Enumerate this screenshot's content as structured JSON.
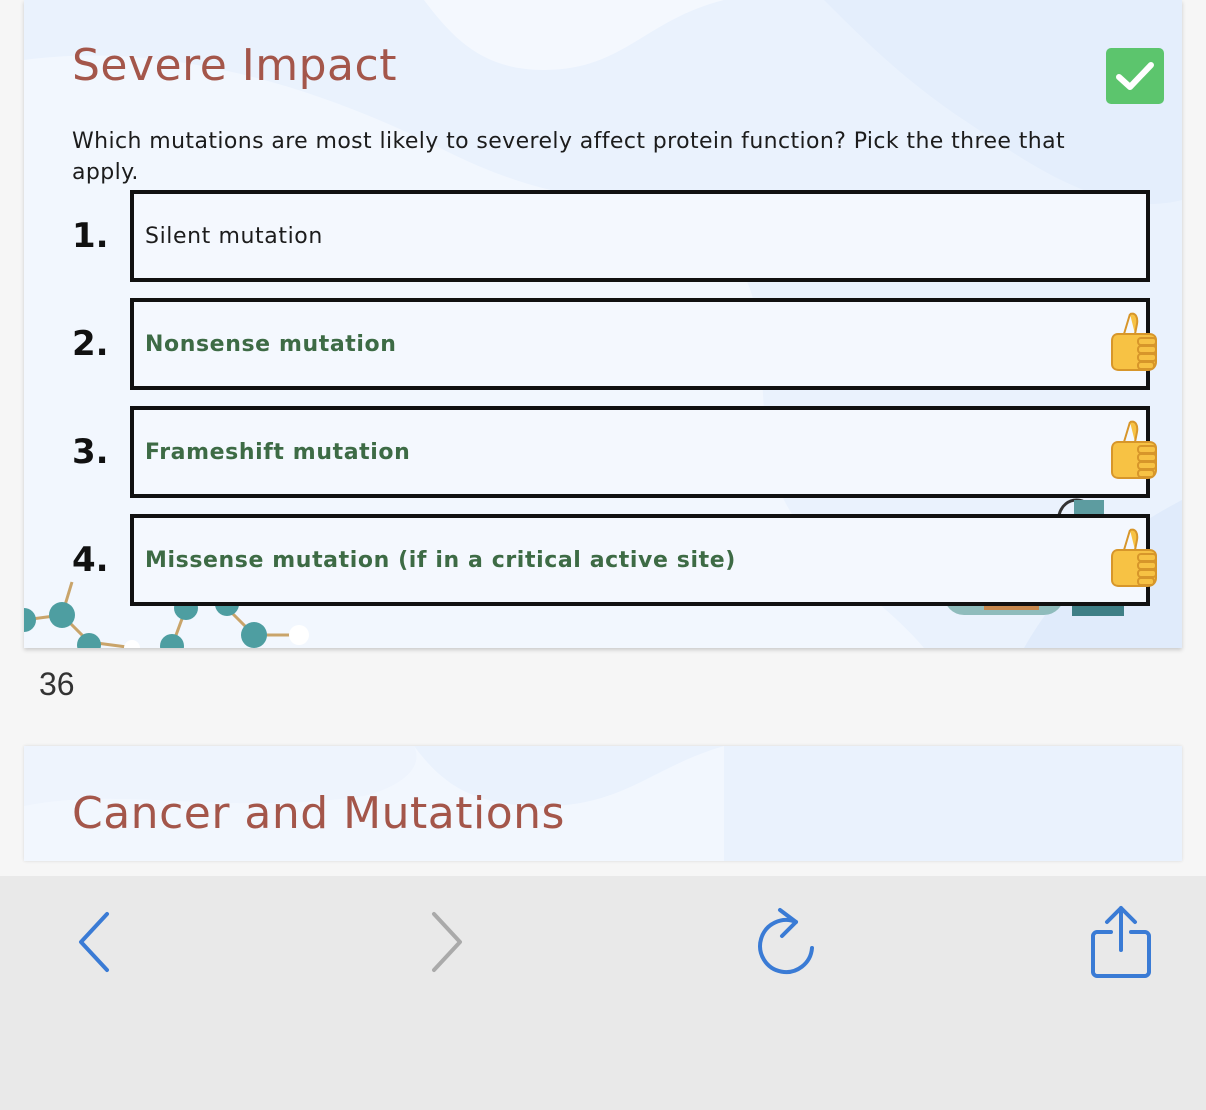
{
  "slide": {
    "title": "Severe Impact",
    "question": "Which mutations are most likely to severely affect protein function? Pick the three that apply.",
    "options": [
      {
        "number": "1.",
        "text": "Silent mutation",
        "correct": false
      },
      {
        "number": "2.",
        "text": "Nonsense mutation",
        "correct": true
      },
      {
        "number": "3.",
        "text": "Frameshift mutation",
        "correct": true
      },
      {
        "number": "4.",
        "text": "Missense mutation (if in a critical active site)",
        "correct": true
      }
    ],
    "badge_icon": "checkmark-icon",
    "feedback_icon": "thumbs-up-icon"
  },
  "page_number": "36",
  "next_slide": {
    "title": "Cancer and Mutations"
  },
  "toolbar": {
    "buttons": [
      {
        "name": "back",
        "icon": "chevron-left-icon",
        "enabled": true
      },
      {
        "name": "forward",
        "icon": "chevron-right-icon",
        "enabled": false
      },
      {
        "name": "reload",
        "icon": "reload-icon",
        "enabled": true
      },
      {
        "name": "share",
        "icon": "share-icon",
        "enabled": true
      }
    ]
  },
  "colors": {
    "title": "#a4564a",
    "correct_text": "#3d6b45",
    "badge": "#5cc56d",
    "toolbar_icon": "#3a7bd5",
    "toolbar_icon_disabled": "#aaaaaa"
  }
}
